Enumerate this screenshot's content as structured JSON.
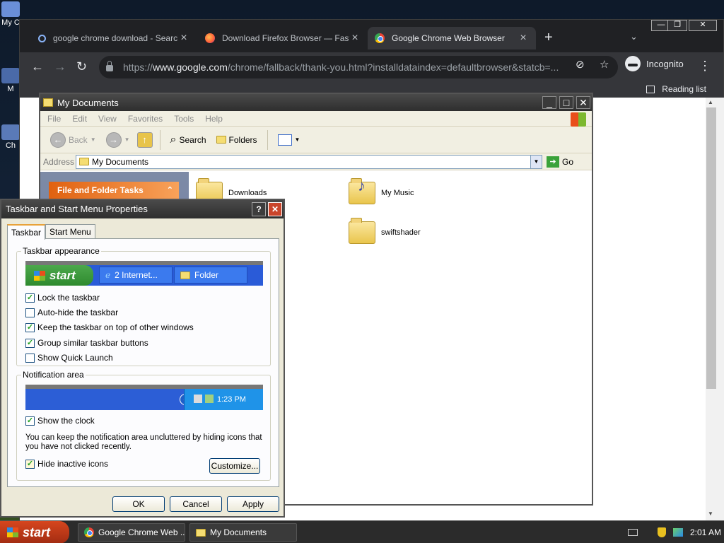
{
  "desktop": {
    "icons": [
      {
        "label": "My C",
        "color": "#6a8fd8"
      },
      {
        "label": "M",
        "color": "#4a6aa8"
      },
      {
        "label": "Ch",
        "color": "#5a7ab8"
      }
    ]
  },
  "chrome": {
    "tabs": [
      {
        "title": "google chrome download - Search",
        "icon": "search-icon",
        "active": false
      },
      {
        "title": "Download Firefox Browser — Fast, P",
        "icon": "firefox-icon",
        "active": false
      },
      {
        "title": "Google Chrome Web Browser",
        "icon": "chrome-icon",
        "active": true
      }
    ],
    "new_tab": "+",
    "tab_search": "⌄",
    "window_controls": [
      "—",
      "❐",
      "✕"
    ],
    "nav": {
      "back": "←",
      "forward": "→",
      "reload": "↻"
    },
    "url_prefix": "https://",
    "url_host": "www.google.com",
    "url_path": "/chrome/fallback/thank-you.html?installdataindex=defaultbrowser&statcb=...",
    "incognito_label": "Incognito",
    "menu": "⋮",
    "reading_list": "Reading list"
  },
  "explorer": {
    "title": "My Documents",
    "menu": [
      "File",
      "Edit",
      "View",
      "Favorites",
      "Tools",
      "Help"
    ],
    "toolbar": {
      "back": "Back",
      "search": "Search",
      "folders": "Folders"
    },
    "address_label": "Address",
    "address_value": "My Documents",
    "go_label": "Go",
    "task_header": "File and Folder Tasks",
    "items": [
      {
        "name": "Downloads",
        "type": "folder"
      },
      {
        "name": "My Music",
        "type": "music-folder"
      },
      {
        "name": "swiftshader",
        "type": "folder"
      }
    ]
  },
  "dialog": {
    "title": "Taskbar and Start Menu Properties",
    "help": "?",
    "close": "✕",
    "tabs": [
      "Taskbar",
      "Start Menu"
    ],
    "appearance": {
      "legend": "Taskbar appearance",
      "preview_start": "start",
      "preview_task1": "2 Internet...",
      "preview_task2": "Folder",
      "options": [
        {
          "label": "Lock the taskbar",
          "checked": true
        },
        {
          "label": "Auto-hide the taskbar",
          "checked": false
        },
        {
          "label": "Keep the taskbar on top of other windows",
          "checked": true
        },
        {
          "label": "Group similar taskbar buttons",
          "checked": true
        },
        {
          "label": "Show Quick Launch",
          "checked": false
        }
      ]
    },
    "notification": {
      "legend": "Notification area",
      "preview_time": "1:23 PM",
      "show_clock": {
        "label": "Show the clock",
        "checked": true
      },
      "description": "You can keep the notification area uncluttered by hiding icons that you have not clicked recently.",
      "hide_inactive": {
        "label": "Hide inactive icons",
        "checked": true
      },
      "customize": "Customize..."
    },
    "buttons": {
      "ok": "OK",
      "cancel": "Cancel",
      "apply": "Apply"
    }
  },
  "taskbar": {
    "start": "start",
    "tasks": [
      "Google Chrome Web ...",
      "My Documents"
    ],
    "clock": "2:01 AM"
  }
}
